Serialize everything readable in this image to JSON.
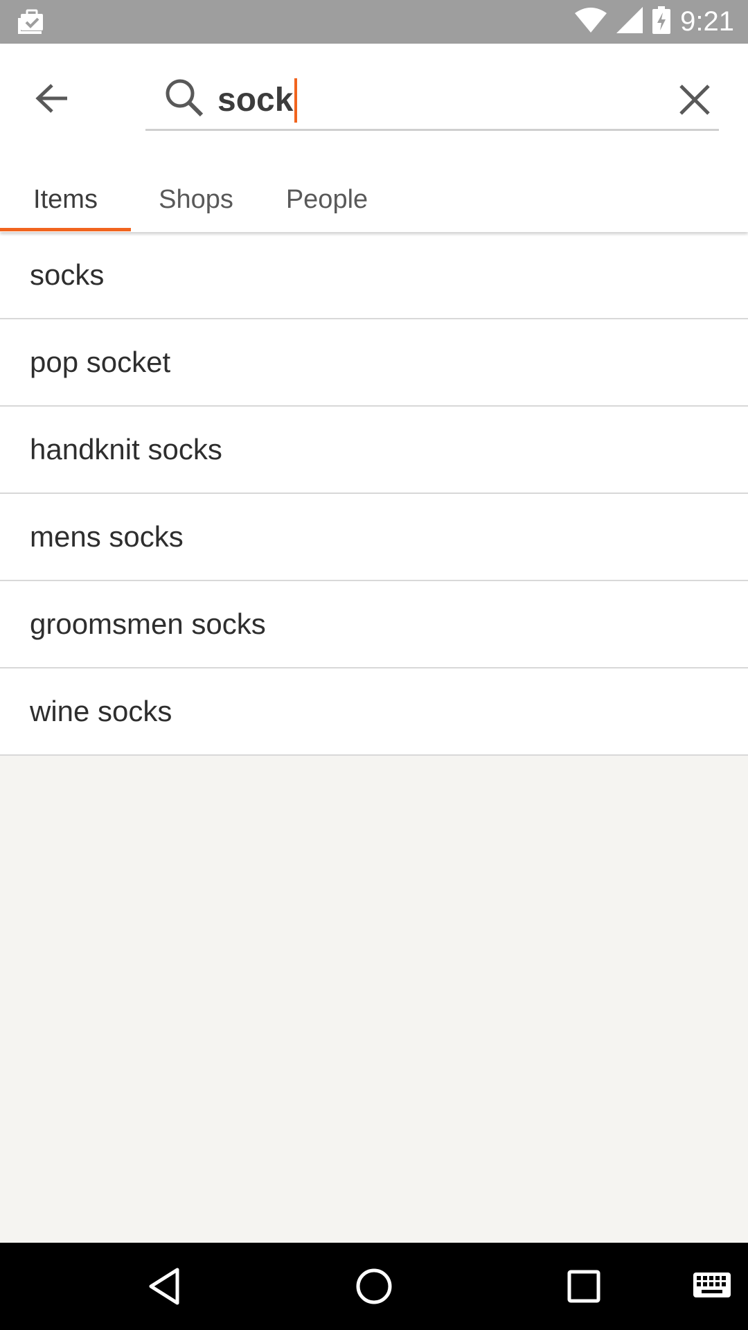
{
  "status_bar": {
    "time": "9:21"
  },
  "search": {
    "query": "sock"
  },
  "tabs": [
    {
      "label": "Items",
      "active": true
    },
    {
      "label": "Shops",
      "active": false
    },
    {
      "label": "People",
      "active": false
    }
  ],
  "suggestions": [
    "socks",
    "pop socket",
    "handknit socks",
    "mens socks",
    "groomsmen socks",
    "wine socks"
  ],
  "colors": {
    "accent": "#f1641e",
    "status_bar": "#9e9e9e",
    "background": "#f5f4f1"
  },
  "icons": {
    "notification": "work-briefcase-check-icon",
    "wifi": "wifi-icon",
    "signal": "cell-signal-icon",
    "battery": "battery-charging-icon",
    "back": "arrow-left-icon",
    "search": "search-icon",
    "clear": "close-icon",
    "nav_back": "triangle-back-icon",
    "nav_home": "circle-home-icon",
    "nav_recents": "square-recents-icon",
    "keyboard": "keyboard-icon"
  }
}
